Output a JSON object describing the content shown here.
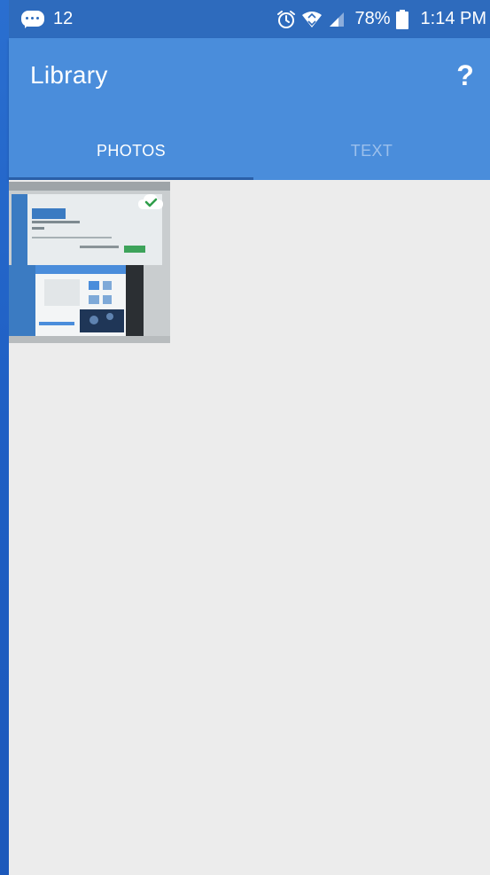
{
  "status_bar": {
    "notification_count": "12",
    "battery_percent": "78%",
    "time": "1:14 PM",
    "icons": [
      "message-icon",
      "alarm-icon",
      "wifi-icon",
      "signal-icon",
      "battery-icon"
    ]
  },
  "app_bar": {
    "title": "Library",
    "help_label": "?"
  },
  "tabs": [
    {
      "label": "PHOTOS",
      "selected": true
    },
    {
      "label": "TEXT",
      "selected": false
    }
  ],
  "photos": [
    {
      "synced": true,
      "icon": "cloud-check-icon"
    }
  ],
  "colors": {
    "status_bar": "#2e6bbd",
    "app_bar": "#4a8ddb",
    "tab_indicator": "#2a5fa8",
    "inactive_tab": "#9cc0ec",
    "content_background": "#ececec",
    "sync_check": "#2f9e4a"
  }
}
